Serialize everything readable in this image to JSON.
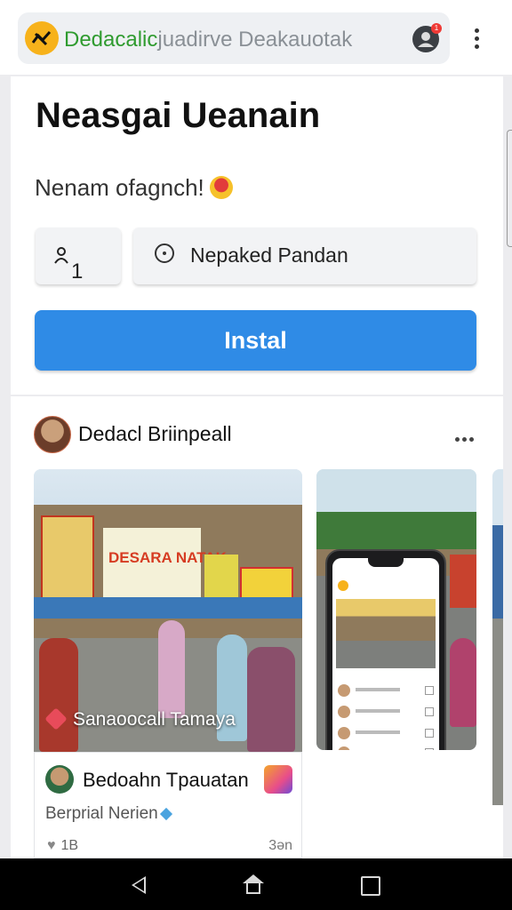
{
  "browser": {
    "url_highlight": "Dedacalic",
    "url_rest": "juadirve Deakauotak",
    "notification_count": "1"
  },
  "main": {
    "headline": "Neasgai Ueanain",
    "greeting": "Nenam ofagnch!",
    "guest_field_value": "1",
    "location_field_value": "Nepaked Pandan",
    "install_label": "Instal"
  },
  "post": {
    "author": "Dedacl Briinpeall",
    "photo_caption": "Sanaoocall Tamaya",
    "card_name": "Bedoahn Tpauatan",
    "card_subtitle": "Berprial Nerien",
    "likes": "1B",
    "time": "3ǝn"
  },
  "colors": {
    "accent": "#2f8be6",
    "url_green": "#2f9b2f",
    "logo_yellow": "#f7b21b"
  },
  "icons": [
    "logo-icon",
    "profile-icon",
    "more-vert-icon",
    "person-icon",
    "clock-icon",
    "more-horiz-icon",
    "back-icon",
    "home-icon",
    "recents-icon"
  ]
}
